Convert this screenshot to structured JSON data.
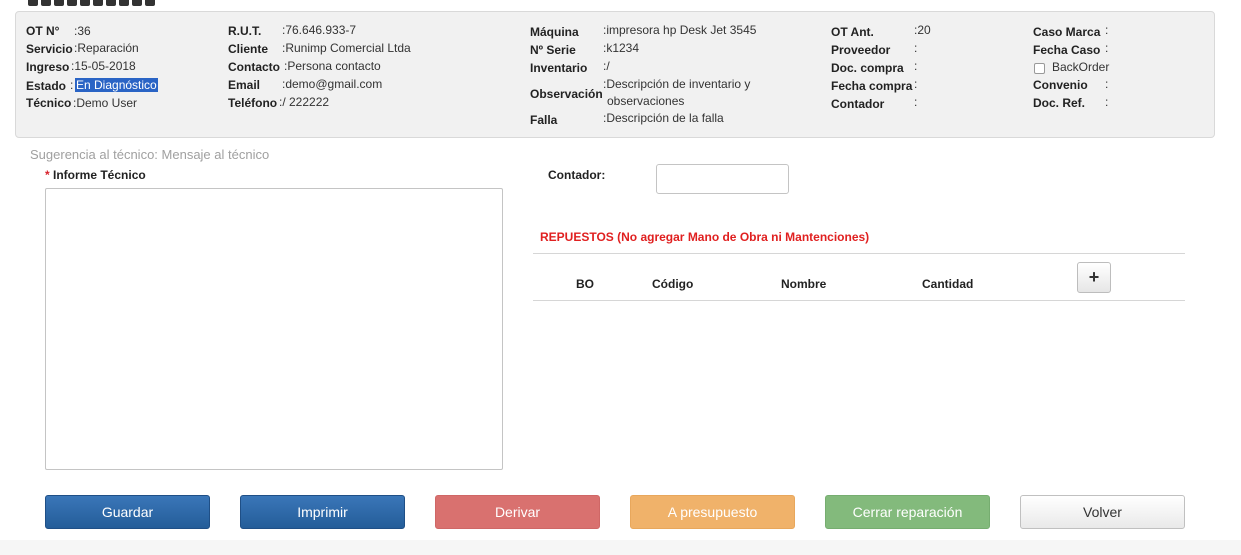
{
  "info": {
    "col1": [
      {
        "label": "OT N°",
        "value": ":36"
      },
      {
        "label": "Servicio",
        "value": ":Reparación"
      },
      {
        "label": "Ingreso",
        "value": ":15-05-2018"
      },
      {
        "label": "Estado",
        "value_prefix": ":",
        "value": "En Diagnóstico"
      },
      {
        "label": "Técnico",
        "value": ":Demo User"
      }
    ],
    "col2": [
      {
        "label": "R.U.T.",
        "value": ":76.646.933-7"
      },
      {
        "label": "Cliente",
        "value": ":Runimp Comercial Ltda"
      },
      {
        "label": "Contacto",
        "value": ":Persona contacto"
      },
      {
        "label": "Email",
        "value": ":demo@gmail.com"
      },
      {
        "label": "Teléfono",
        "value": ":/ 222222"
      }
    ],
    "col3": [
      {
        "label": "Máquina",
        "value": ":impresora hp Desk Jet 3545"
      },
      {
        "label": "Nº Serie",
        "value": ":k1234"
      },
      {
        "label": "Inventario",
        "value": ":/"
      },
      {
        "label": "Observación",
        "value_line1": ":Descripción de inventario y",
        "value_line2": "observaciones"
      },
      {
        "label": "Falla",
        "value": ":Descripción de la falla"
      }
    ],
    "col4": [
      {
        "label": "OT Ant.",
        "value": ":20"
      },
      {
        "label": "Proveedor",
        "value": ":"
      },
      {
        "label": "Doc. compra",
        "value": ":"
      },
      {
        "label": "Fecha compra",
        "value": ":"
      },
      {
        "label": "Contador",
        "value": ":"
      }
    ],
    "col5": [
      {
        "label": "Caso Marca",
        "value": ":"
      },
      {
        "label": "Fecha Caso",
        "value": ":"
      },
      {
        "label": "BackOrder",
        "checked": false
      },
      {
        "label": "Convenio",
        "value": ":"
      },
      {
        "label": "Doc. Ref.",
        "value": ":"
      }
    ]
  },
  "suggestion": "Sugerencia al técnico: Mensaje al técnico",
  "informe": {
    "required_mark": "*",
    "label": "Informe Técnico",
    "value": ""
  },
  "contador": {
    "label": "Contador:",
    "value": ""
  },
  "repuestos": {
    "title": "REPUESTOS (No agregar Mano de Obra ni Mantenciones)",
    "columns": [
      "BO",
      "Código",
      "Nombre",
      "Cantidad"
    ],
    "add_label": "+"
  },
  "buttons": {
    "guardar": "Guardar",
    "imprimir": "Imprimir",
    "derivar": "Derivar",
    "presupuesto": "A presupuesto",
    "cerrar": "Cerrar reparación",
    "volver": "Volver"
  },
  "colors": {
    "primary": "#2d6aa8",
    "danger": "#d9716f",
    "warning": "#f0b26a",
    "success": "#83ba7c",
    "required": "#e02020"
  }
}
